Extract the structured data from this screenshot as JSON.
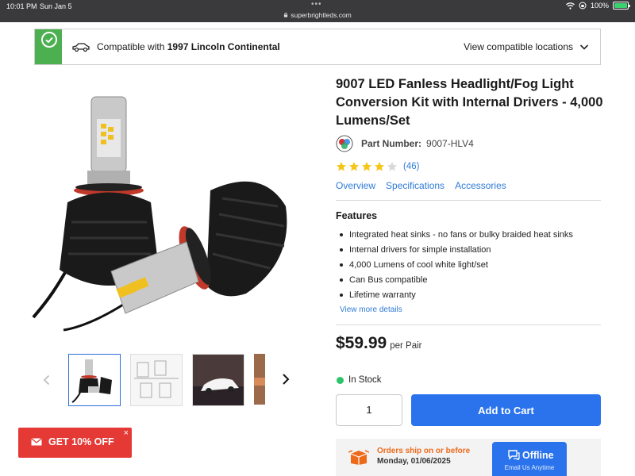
{
  "status_bar": {
    "time": "10:01 PM",
    "date": "Sun Jan 5",
    "dots": "•••",
    "url": "superbrightleds.com",
    "battery": "100%"
  },
  "compat": {
    "prefix": "Compatible with ",
    "vehicle": "1997 Lincoln Continental",
    "view_label": "View compatible locations"
  },
  "product": {
    "title": "9007 LED Fanless Headlight/Fog Light Conversion Kit with Internal Drivers - 4,000 Lumens/Set",
    "part_label": "Part Number:",
    "part_value": "9007-HLV4",
    "rating_stars": 4,
    "review_count": "(46)",
    "tabs": [
      "Overview",
      "Specifications",
      "Accessories"
    ],
    "features_title": "Features",
    "features": [
      "Integrated heat sinks - no fans or bulky braided heat sinks",
      "Internal drivers for simple installation",
      "4,000 Lumens of cool white light/set",
      "Can Bus compatible",
      "Lifetime warranty"
    ],
    "view_more": "View more details",
    "price": "$59.99",
    "price_unit": "per Pair",
    "stock": "In Stock",
    "quantity": "1",
    "add_to_cart": "Add to Cart"
  },
  "shipping": {
    "line1": "Orders ship on or before",
    "line2": "Monday, 01/06/2025"
  },
  "chat": {
    "status": "Offline",
    "sub": "Email Us Anytime"
  },
  "promo": {
    "label": "GET 10% OFF",
    "close": "×"
  },
  "colors": {
    "accent_blue": "#2a73ec",
    "link_blue": "#2f7bd6",
    "compat_green": "#4caf50",
    "promo_red": "#e53935",
    "ship_orange": "#ee6a1b",
    "star_gold": "#f5c518"
  }
}
